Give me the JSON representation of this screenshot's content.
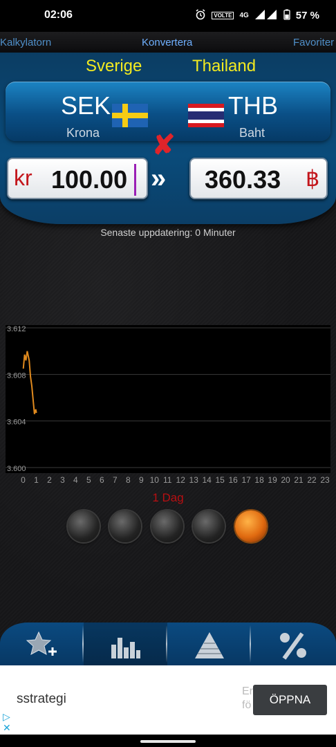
{
  "status_bar": {
    "time": "02:06",
    "icons": [
      "alarm-icon",
      "volte-icon",
      "4g-icon",
      "signal-icon",
      "battery-icon"
    ],
    "volte": "VOLTE",
    "network": "4G",
    "battery": "57 %"
  },
  "nav": {
    "left": "Kalkylatorn",
    "center": "Konvertera",
    "right": "Favoriter"
  },
  "countries": {
    "from": "Sverige",
    "to": "Thailand"
  },
  "pair": {
    "from_code": "SEK",
    "from_name": "Krona",
    "to_code": "THB",
    "to_name": "Baht"
  },
  "converter": {
    "from_symbol": "kr",
    "from_value": "100.00",
    "to_value": "360.33",
    "to_symbol": "฿"
  },
  "last_update": "Senaste uppdatering: 0 Minuter",
  "chart_data": {
    "type": "line",
    "title": "",
    "xlabel": "",
    "ylabel": "",
    "y_ticks": [
      "3.612",
      "3.608",
      "3.604",
      "3.600"
    ],
    "x_ticks": [
      "0",
      "1",
      "2",
      "3",
      "4",
      "5",
      "6",
      "7",
      "8",
      "9",
      "10",
      "11",
      "12",
      "13",
      "14",
      "15",
      "16",
      "17",
      "18",
      "19",
      "20",
      "21",
      "22",
      "23"
    ],
    "xlim": [
      0,
      23.5
    ],
    "ylim": [
      3.6,
      3.612
    ],
    "grid": true,
    "series": [
      {
        "color": "#e08a1e",
        "x": [
          0.0,
          0.1,
          0.2,
          0.3,
          0.45,
          0.55,
          0.65,
          0.75,
          0.85,
          0.95,
          1.0
        ],
        "y": [
          3.6085,
          3.6097,
          3.6092,
          3.61,
          3.6092,
          3.6078,
          3.607,
          3.6058,
          3.6046,
          3.605,
          3.6047
        ]
      }
    ],
    "range_label": "1 Dag"
  },
  "range_selector": {
    "count": 5,
    "selected_index": 4
  },
  "tabs": [
    "star-add-icon",
    "bar-chart-icon",
    "pyramid-icon",
    "percent-icon"
  ],
  "active_tab": 1,
  "ad": {
    "title": "sstrategi",
    "faded_text": "Er\nfö",
    "cta": "ÖPPNA"
  },
  "colors": {
    "accent_blue": "#0a4b7a",
    "country_yellow": "#f3ea20",
    "symbol_red": "#c3161c",
    "chart_line": "#e08a1e",
    "range_red": "#b80f12"
  }
}
